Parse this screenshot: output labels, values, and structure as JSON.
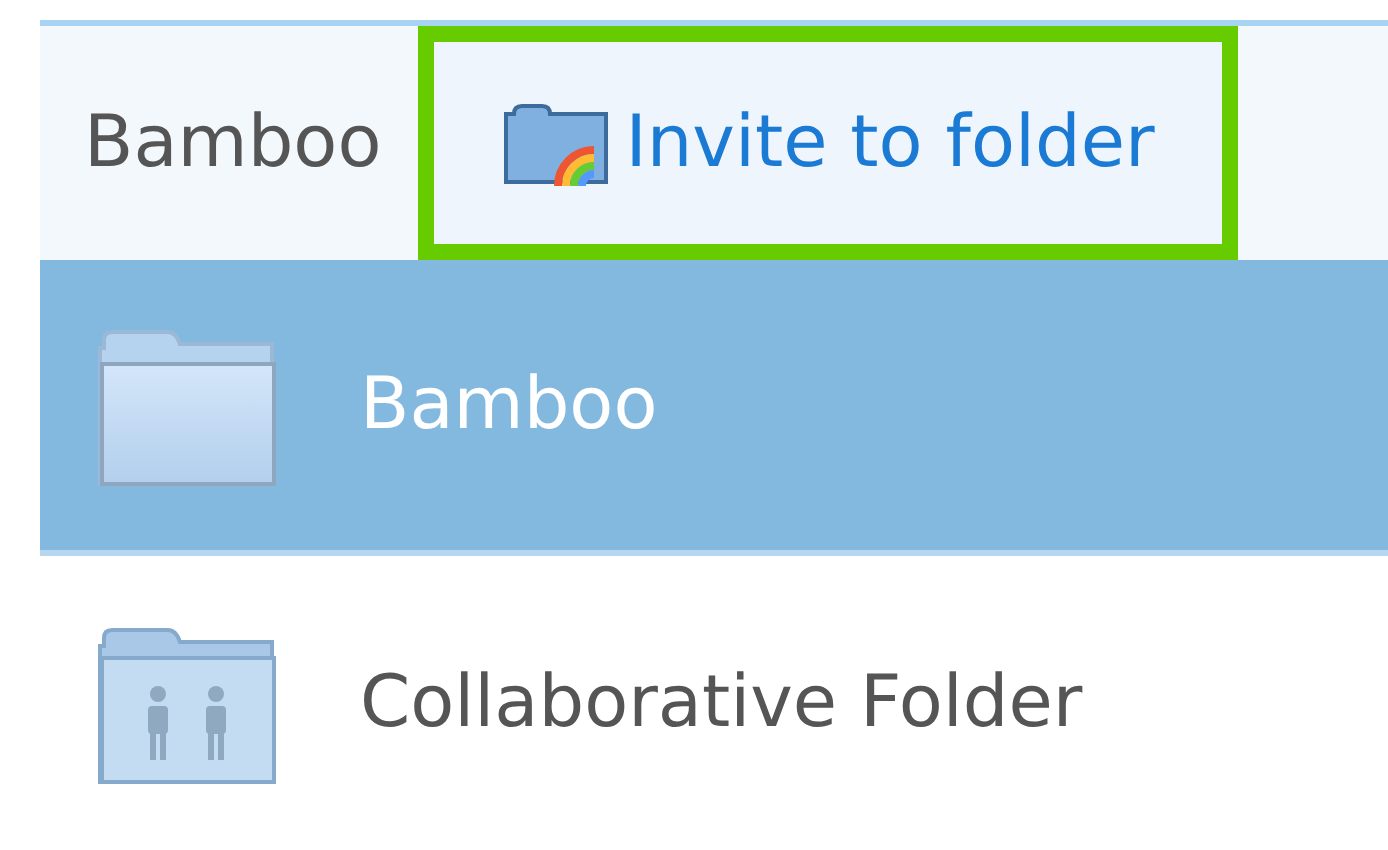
{
  "breadcrumb": "Bamboo",
  "toolbar": {
    "button": {
      "label": "Invite to folder",
      "highlighted": true
    }
  },
  "files": [
    {
      "name": "Bamboo",
      "kind": "folder",
      "selected": true
    },
    {
      "name": "Collaborative Folder",
      "kind": "shared",
      "selected": false
    }
  ]
}
